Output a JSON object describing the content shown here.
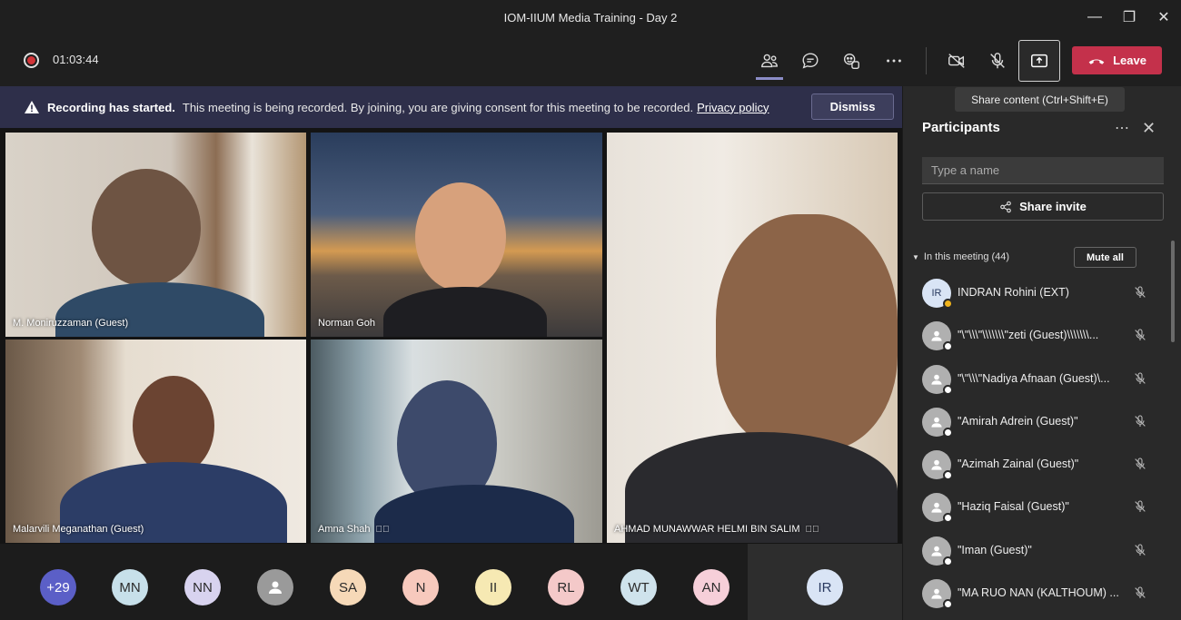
{
  "window": {
    "title": "IOM-IIUM Media Training - Day 2",
    "controls": [
      "minimize-icon",
      "restore-icon",
      "close-icon"
    ]
  },
  "toolbar": {
    "timer": "01:03:44",
    "leave_label": "Leave",
    "icons": [
      "participants-icon",
      "chat-icon",
      "reactions-icon",
      "more-icon",
      "camera-off-icon",
      "mic-off-icon",
      "share-screen-icon"
    ]
  },
  "tooltip": {
    "text": "Share content (Ctrl+Shift+E)"
  },
  "banner": {
    "title": "Recording has started.",
    "text": "This meeting is being recorded. By joining, you are giving consent for this meeting to be recorded.",
    "link": "Privacy policy",
    "dismiss_label": "Dismiss"
  },
  "videos": [
    {
      "name": "M. Moniruzzaman (Guest)"
    },
    {
      "name": "Norman Goh"
    },
    {
      "name": "AHMAD MUNAWWAR HELMI BIN SALIM"
    },
    {
      "name": "Malarvili Meganathan (Guest)"
    },
    {
      "name": "Amna Shah"
    }
  ],
  "strip": {
    "avatars": [
      {
        "initials": "+29",
        "color": "#5b5fc7"
      },
      {
        "initials": "MN",
        "color": "#c7e0ea"
      },
      {
        "initials": "NN",
        "color": "#d8d3ef"
      },
      {
        "initials": "",
        "color": "#9a9a9a"
      },
      {
        "initials": "SA",
        "color": "#f6d9b8"
      },
      {
        "initials": "N",
        "color": "#f7c9bd"
      },
      {
        "initials": "II",
        "color": "#f6e9b3"
      },
      {
        "initials": "RL",
        "color": "#f4c9c9"
      },
      {
        "initials": "WT",
        "color": "#cfe3ec"
      },
      {
        "initials": "AN",
        "color": "#f6cfd9"
      }
    ],
    "self_initials": "IR"
  },
  "panel": {
    "title": "Participants",
    "search_placeholder": "Type a name",
    "share_invite_label": "Share invite",
    "section_label": "In this meeting (44)",
    "mute_all_label": "Mute all",
    "participants": [
      {
        "initials": "IR",
        "name": "INDRAN Rohini (EXT)"
      },
      {
        "initials": "",
        "name": "\"\\\"\\\\\\\"\\\\\\\\\\\\\\\"zeti (Guest)\\\\\\\\\\\\\\..."
      },
      {
        "initials": "",
        "name": "\"\\\"\\\\\\\"Nadiya Afnaan (Guest)\\..."
      },
      {
        "initials": "",
        "name": "\"Amirah Adrein (Guest)\""
      },
      {
        "initials": "",
        "name": "\"Azimah Zainal (Guest)\""
      },
      {
        "initials": "",
        "name": "\"Haziq Faisal (Guest)\""
      },
      {
        "initials": "",
        "name": "\"Iman (Guest)\""
      },
      {
        "initials": "",
        "name": "\"MA RUO NAN (KALTHOUM) ..."
      }
    ]
  }
}
